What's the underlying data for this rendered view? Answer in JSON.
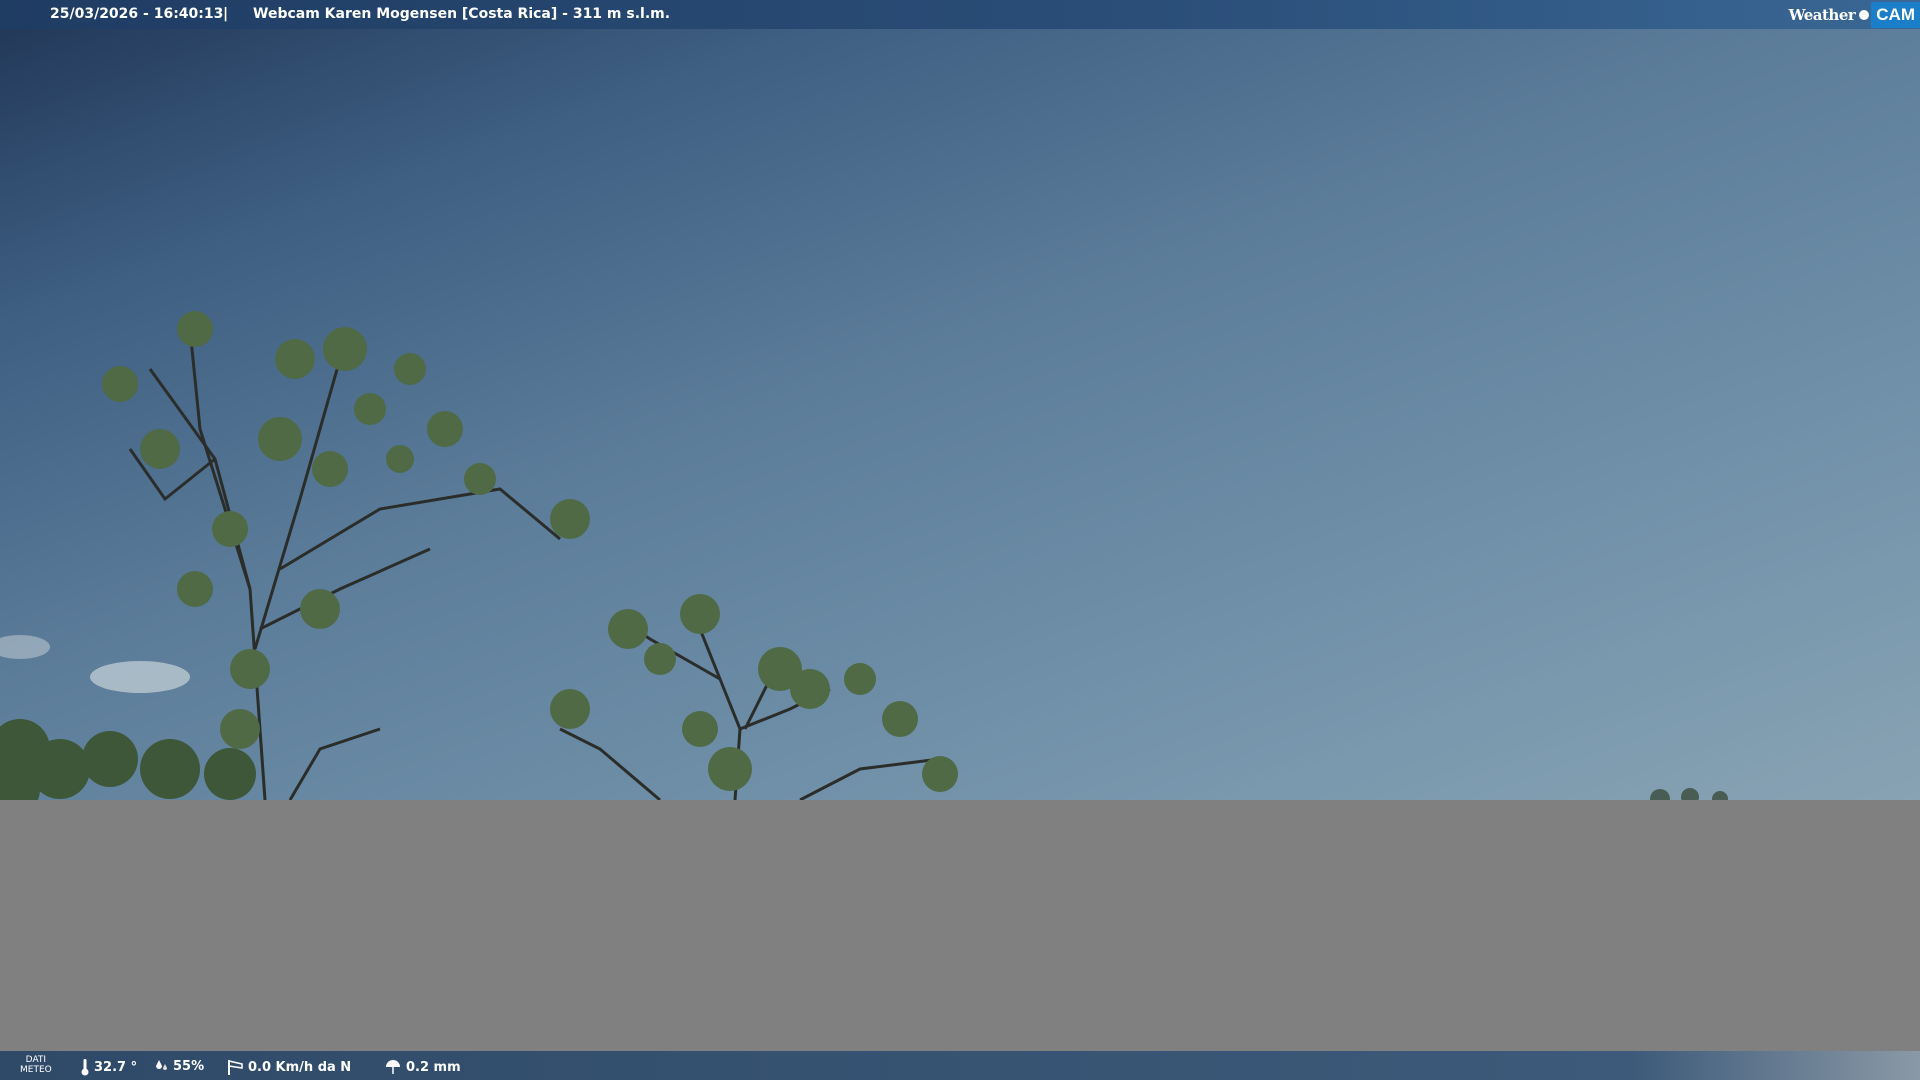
{
  "topbar": {
    "datetime": "25/03/2026 - 16:40:13",
    "separator": "|",
    "title": "Webcam Karen Mogensen [Costa Rica]  - 311 m s.l.m."
  },
  "logo": {
    "weather": "Weather",
    "cam": "CAM"
  },
  "bottombar": {
    "label_line1": "DATI",
    "label_line2": "METEO",
    "temperature": "32.7 °",
    "humidity": "55%",
    "wind": "0.0 Km/h da N",
    "rain": "0.2 mm"
  },
  "colors": {
    "sky_top": "#23395a",
    "sky_bottom": "#88a3b3",
    "overlay_gray": "#808080",
    "logo_accent": "#1b7ec9"
  }
}
